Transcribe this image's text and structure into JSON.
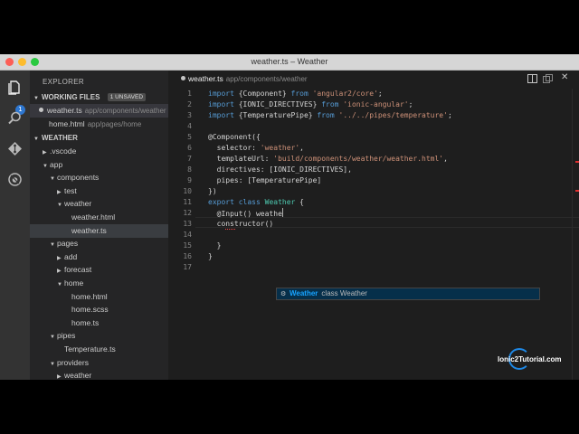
{
  "window": {
    "title": "weather.ts – Weather"
  },
  "activity_bar": {
    "icons": [
      "files-icon",
      "search-icon",
      "git-icon",
      "debug-icon"
    ],
    "badge": "1"
  },
  "sidebar": {
    "title": "EXPLORER",
    "working_files": {
      "label": "WORKING FILES",
      "badge": "1 UNSAVED",
      "items": [
        {
          "name": "weather.ts",
          "path": "app/components/weather"
        },
        {
          "name": "home.html",
          "path": "app/pages/home"
        }
      ]
    },
    "project": {
      "label": "WEATHER",
      "tree": [
        {
          "name": ".vscode",
          "arrow": "▶"
        },
        {
          "name": "app",
          "arrow": "▼"
        },
        {
          "name": "components",
          "arrow": "▼"
        },
        {
          "name": "test",
          "arrow": "▶"
        },
        {
          "name": "weather",
          "arrow": "▼"
        },
        {
          "name": "weather.html",
          "arrow": ""
        },
        {
          "name": "weather.ts",
          "arrow": ""
        },
        {
          "name": "pages",
          "arrow": "▼"
        },
        {
          "name": "add",
          "arrow": "▶"
        },
        {
          "name": "forecast",
          "arrow": "▶"
        },
        {
          "name": "home",
          "arrow": "▼"
        },
        {
          "name": "home.html",
          "arrow": ""
        },
        {
          "name": "home.scss",
          "arrow": ""
        },
        {
          "name": "home.ts",
          "arrow": ""
        },
        {
          "name": "pipes",
          "arrow": "▼"
        },
        {
          "name": "Temperature.ts",
          "arrow": ""
        },
        {
          "name": "providers",
          "arrow": "▼"
        },
        {
          "name": "weather",
          "arrow": "▶"
        }
      ]
    }
  },
  "editor": {
    "tab": {
      "name": "weather.ts",
      "path": "app/components/weather"
    },
    "line_numbers": [
      "1",
      "2",
      "3",
      "4",
      "5",
      "6",
      "7",
      "8",
      "9",
      "10",
      "11",
      "12",
      "13",
      "14",
      "15",
      "16",
      "17"
    ],
    "lines": [
      [
        [
          "kw",
          "import "
        ],
        [
          "",
          "{Component} "
        ],
        [
          "kw",
          "from "
        ],
        [
          "str",
          "'angular2/core'"
        ],
        [
          "",
          ";"
        ]
      ],
      [
        [
          "kw",
          "import "
        ],
        [
          "",
          "{IONIC_DIRECTIVES} "
        ],
        [
          "kw",
          "from "
        ],
        [
          "str",
          "'ionic-angular'"
        ],
        [
          "",
          ";"
        ]
      ],
      [
        [
          "kw",
          "import "
        ],
        [
          "",
          "{TemperaturePipe} "
        ],
        [
          "kw",
          "from "
        ],
        [
          "str",
          "'../../pipes/temperature'"
        ],
        [
          "",
          ";"
        ]
      ],
      [],
      [
        [
          "",
          "@Component({"
        ]
      ],
      [
        [
          "",
          "  selector: "
        ],
        [
          "str",
          "'weather'"
        ],
        [
          "",
          ","
        ]
      ],
      [
        [
          "",
          "  templateUrl: "
        ],
        [
          "str",
          "'build/components/weather/weather.html'"
        ],
        [
          "",
          ","
        ]
      ],
      [
        [
          "",
          "  directives: [IONIC_DIRECTIVES],"
        ]
      ],
      [
        [
          "",
          "  pipes: [TemperaturePipe]"
        ]
      ],
      [
        [
          "",
          "})"
        ]
      ],
      [
        [
          "kw",
          "export "
        ],
        [
          "kw",
          "class "
        ],
        [
          "cls",
          "Weather "
        ],
        [
          "",
          "{"
        ]
      ],
      [
        [
          "",
          "  @Input() weathe"
        ]
      ],
      [
        [
          "",
          "  constructor() "
        ]
      ],
      [],
      [
        [
          "",
          "  }"
        ]
      ],
      [
        [
          "",
          "}"
        ]
      ],
      []
    ],
    "suggestion": {
      "icon": "class-icon",
      "name": "Weather",
      "detail": "class Weather"
    }
  },
  "watermark": {
    "text": "Ionic2Tutorial.com"
  },
  "colors": {
    "keyword": "#569cd6",
    "string": "#ce9178",
    "class": "#4ec9b0",
    "accent": "#2e77d0"
  }
}
